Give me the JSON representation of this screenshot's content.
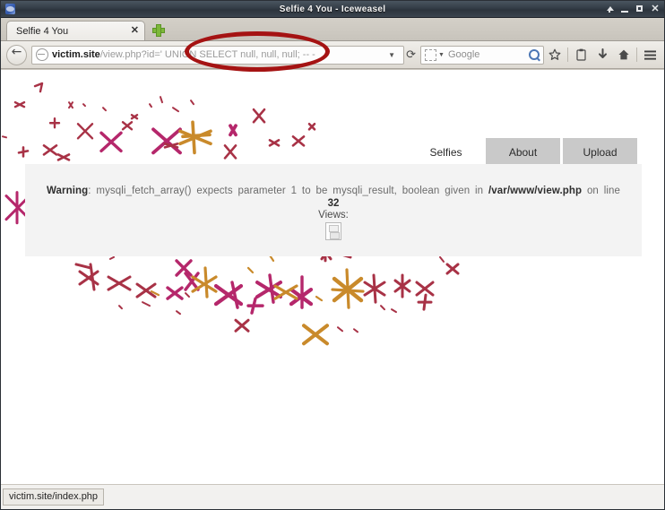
{
  "window": {
    "title": "Selfie 4 You - Iceweasel",
    "app_icon": "iceweasel-icon",
    "controls": {
      "shade": "shade-window-button",
      "minimize": "minimize-window-button",
      "maximize": "maximize-window-button",
      "close_glyph": "✕"
    }
  },
  "browser": {
    "tab": {
      "label": "Selfie 4 You",
      "close_glyph": "✕"
    },
    "new_tab_tooltip": "new-tab",
    "nav": {
      "back_label": "Back",
      "url_host": "victim.site",
      "url_path": "/view.php?id=' UNION SELECT null, null, null; -- -",
      "url_full": "victim.site/view.php?id=' UNION SELECT null, null, null; -- -",
      "dropdown_glyph": "▼",
      "reload_glyph": "⟳"
    },
    "search": {
      "placeholder": "Google",
      "caret_glyph": "▼"
    },
    "toolbar_icons": {
      "bookmark_star": "☆",
      "clipboard": "ὌB",
      "download": "⬇",
      "home": "⌂",
      "menu": "☰"
    },
    "statusbar": {
      "link_target": "victim.site/index.php"
    }
  },
  "page": {
    "nav_tabs": [
      {
        "label": "Selfies",
        "active": true
      },
      {
        "label": "About",
        "active": false
      },
      {
        "label": "Upload",
        "active": false
      }
    ],
    "warning": {
      "prefix": "Warning",
      "colon": ":",
      "body_1": "mysqli_fetch_array() expects parameter 1 to be mysqli_result, boolean given in",
      "file": "/var/www/view.php",
      "body_2": "on line",
      "line_number": "32",
      "full_text": "Warning: mysqli_fetch_array() expects parameter 1 to be mysqli_result, boolean given in /var/www/view.php on line 32"
    },
    "views": {
      "label": "Views:",
      "image_state": "broken-image-icon"
    }
  },
  "annotation": {
    "type": "ellipse-highlight",
    "color": "#a51313",
    "target_text": "UNION SELECT null, null, null; -- -"
  },
  "colors": {
    "titlebar": "#343d47",
    "panel_bg": "#f3f3f3",
    "tab_inactive": "#c9c9c9",
    "tab_active": "#ffffff",
    "annotation_red": "#a51313",
    "scatter_magenta": "#b5276b",
    "scatter_crimson": "#a83246",
    "scatter_gold": "#c98a2b"
  },
  "scatter_art": {
    "description": "hand-drawn X / cross / check marks",
    "palette": [
      "#b5276b",
      "#a83246",
      "#c98a2b",
      "#d4a04a",
      "#8e2a4f"
    ]
  }
}
